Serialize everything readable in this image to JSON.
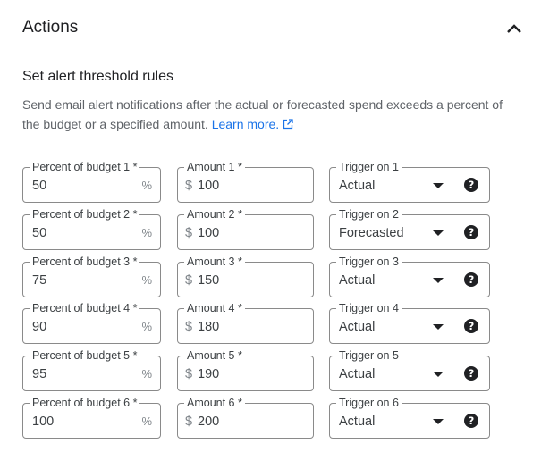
{
  "section": {
    "title": "Actions",
    "collapse_icon": "chevron-up-icon"
  },
  "threshold": {
    "heading": "Set alert threshold rules",
    "description": "Send email alert notifications after the actual or forecasted spend exceeds a percent of the budget or a specified amount.",
    "learn_more": "Learn more.",
    "learn_more_icon": "external-link-icon",
    "percent_suffix": "%",
    "currency_prefix": "$",
    "rules": [
      {
        "percent_label": "Percent of budget 1 *",
        "percent": "50",
        "amount_label": "Amount 1 *",
        "amount": "100",
        "trigger_label": "Trigger on 1",
        "trigger": "Actual"
      },
      {
        "percent_label": "Percent of budget 2 *",
        "percent": "50",
        "amount_label": "Amount 2 *",
        "amount": "100",
        "trigger_label": "Trigger on 2",
        "trigger": "Forecasted"
      },
      {
        "percent_label": "Percent of budget 3 *",
        "percent": "75",
        "amount_label": "Amount 3 *",
        "amount": "150",
        "trigger_label": "Trigger on 3",
        "trigger": "Actual"
      },
      {
        "percent_label": "Percent of budget 4 *",
        "percent": "90",
        "amount_label": "Amount 4 *",
        "amount": "180",
        "trigger_label": "Trigger on 4",
        "trigger": "Actual"
      },
      {
        "percent_label": "Percent of budget 5 *",
        "percent": "95",
        "amount_label": "Amount 5 *",
        "amount": "190",
        "trigger_label": "Trigger on 5",
        "trigger": "Actual"
      },
      {
        "percent_label": "Percent of budget 6 *",
        "percent": "100",
        "amount_label": "Amount 6 *",
        "amount": "200",
        "trigger_label": "Trigger on 6",
        "trigger": "Actual"
      }
    ],
    "help_glyph": "?"
  }
}
